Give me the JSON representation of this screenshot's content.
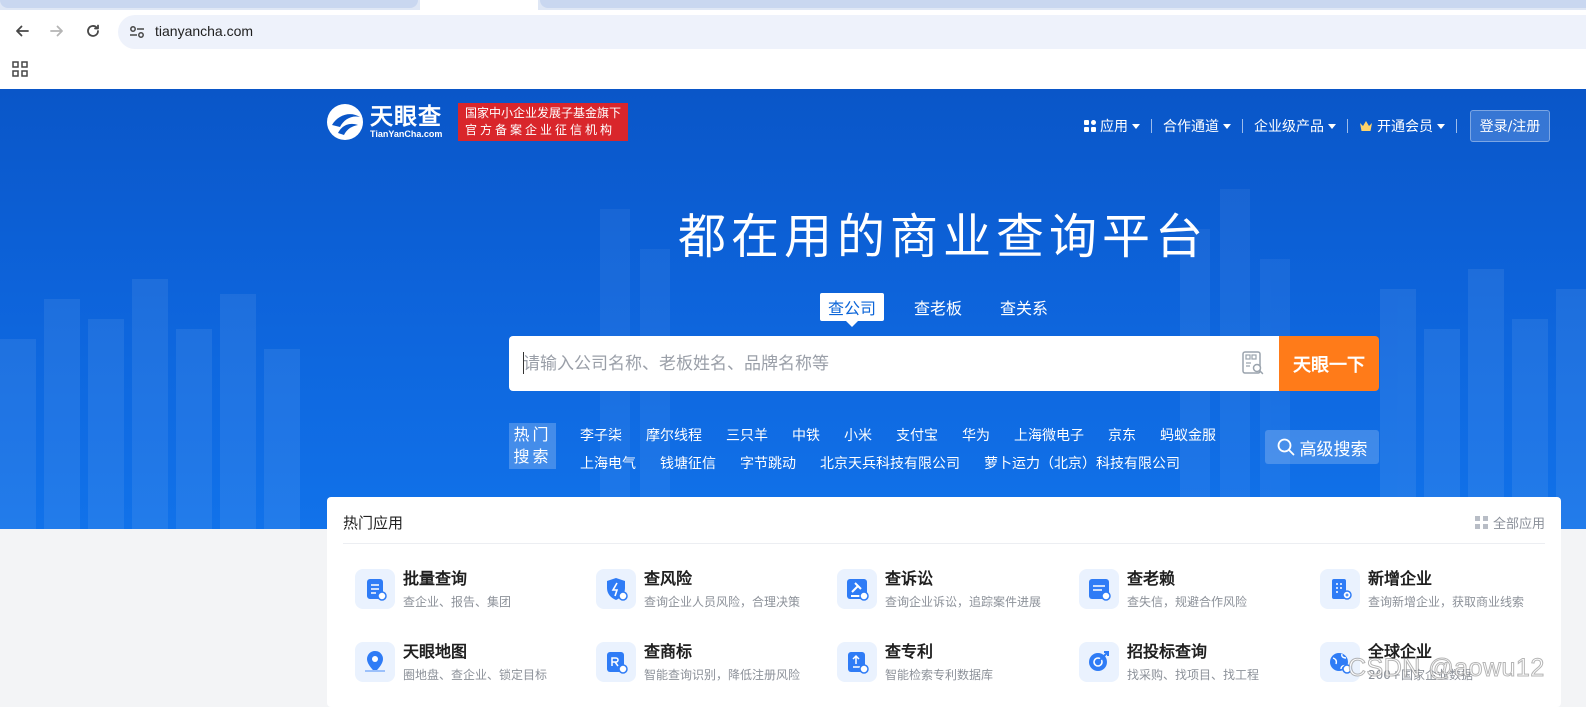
{
  "browser": {
    "url": "tianyancha.com"
  },
  "site": {
    "logo_cn": "天眼查",
    "logo_en": "TianYanCha.com",
    "badge_line1": "国家中小企业发展子基金旗下",
    "badge_line2": "官方备案企业征信机构"
  },
  "nav": {
    "apps": "应用",
    "partner": "合作通道",
    "enterprise": "企业级产品",
    "vip": "开通会员",
    "login": "登录/注册"
  },
  "hero": {
    "slogan": "都在用的商业查询平台"
  },
  "search": {
    "tabs": [
      "查公司",
      "查老板",
      "查关系"
    ],
    "active_tab": "查公司",
    "placeholder": "请输入公司名称、老板姓名、品牌名称等",
    "button": "天眼一下",
    "advanced": "高级搜索"
  },
  "hot_search": {
    "label_line1": "热门",
    "label_line2": "搜索",
    "row1": [
      "李子柒",
      "摩尔线程",
      "三只羊",
      "中铁",
      "小米",
      "支付宝",
      "华为",
      "上海微电子",
      "京东",
      "蚂蚁金服"
    ],
    "row2": [
      "上海电气",
      "钱塘征信",
      "字节跳动",
      "北京天兵科技有限公司",
      "萝卜运力（北京）科技有限公司"
    ]
  },
  "hot_apps": {
    "title": "热门应用",
    "all": "全部应用",
    "items": [
      {
        "name": "批量查询",
        "desc": "查企业、报告、集团",
        "icon": "batch-doc-icon"
      },
      {
        "name": "查风险",
        "desc": "查询企业人员风险，合理决策",
        "icon": "risk-shield-icon"
      },
      {
        "name": "查诉讼",
        "desc": "查询企业诉讼，追踪案件进展",
        "icon": "gavel-icon"
      },
      {
        "name": "查老赖",
        "desc": "查失信，规避合作风险",
        "icon": "dishonest-icon"
      },
      {
        "name": "新增企业",
        "desc": "查询新增企业，获取商业线索",
        "icon": "new-company-icon"
      },
      {
        "name": "天眼地图",
        "desc": "圈地盘、查企业、锁定目标",
        "icon": "map-pin-icon"
      },
      {
        "name": "查商标",
        "desc": "智能查询识别，降低注册风险",
        "icon": "trademark-icon"
      },
      {
        "name": "查专利",
        "desc": "智能检索专利数据库",
        "icon": "patent-icon"
      },
      {
        "name": "招投标查询",
        "desc": "找采购、找项目、找工程",
        "icon": "bidding-icon"
      },
      {
        "name": "全球企业",
        "desc": "200+国家企业数据",
        "icon": "globe-icon"
      }
    ]
  },
  "watermark": "CSDN @aowu12",
  "colors": {
    "hero_blue": "#0d63da",
    "search_orange": "#ff7b19",
    "badge_red": "#d9262b"
  }
}
